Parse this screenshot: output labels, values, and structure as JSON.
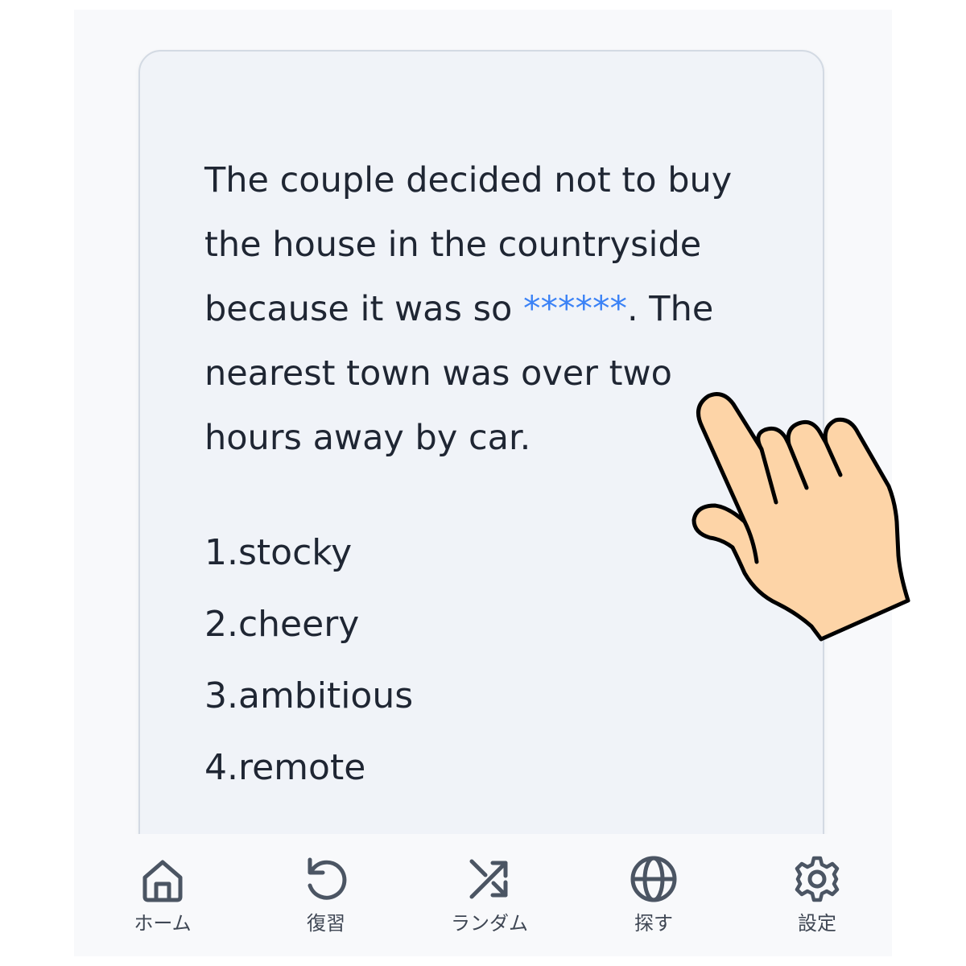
{
  "question": {
    "before_blank": "The couple decided not to buy the house in the countryside because it was so ",
    "blank": "******",
    "after_blank": ". The nearest town was over two hours away by car."
  },
  "options": [
    "1.stocky",
    "2.cheery",
    "3.ambitious",
    "4.remote"
  ],
  "nav": {
    "home": {
      "label": "ホーム",
      "icon": "home-icon"
    },
    "review": {
      "label": "復習",
      "icon": "history-icon"
    },
    "random": {
      "label": "ランダム",
      "icon": "shuffle-icon"
    },
    "search": {
      "label": "探す",
      "icon": "globe-icon"
    },
    "settings": {
      "label": "設定",
      "icon": "gear-icon"
    }
  },
  "colors": {
    "blank": "#3b82f6",
    "text": "#1f2633",
    "card_bg": "#f0f3f8",
    "nav_icon": "#4b5563",
    "hand_fill": "#fdd4a7"
  }
}
